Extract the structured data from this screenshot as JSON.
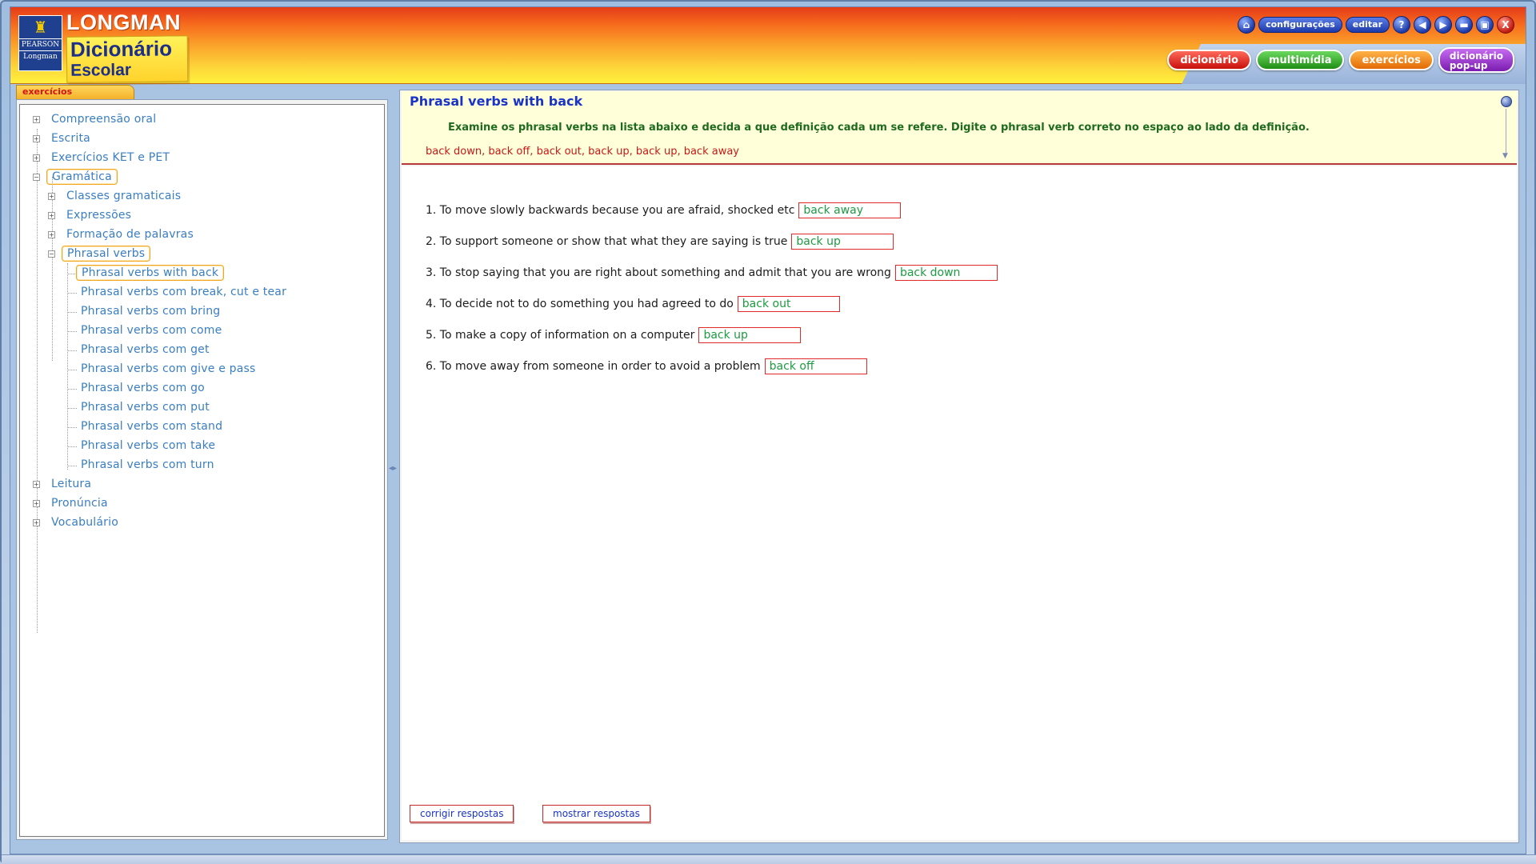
{
  "header": {
    "logo_ship_glyph": "♜",
    "logo_pearson": "PEARSON",
    "logo_longman_small": "Longman",
    "logo_longman": "LONGMAN",
    "logo_dicionario": "Dicionário",
    "logo_escolar": "Escolar"
  },
  "toolbar": {
    "home_glyph": "⌂",
    "configuracoes": "configurações",
    "editar": "editar",
    "help_glyph": "?",
    "back_glyph": "◀",
    "forward_glyph": "▶",
    "minimize_glyph": "▬",
    "maximize_glyph": "▣",
    "close_glyph": "X"
  },
  "nav_tabs": {
    "dicionario": "dicionário",
    "multimidia": "multimídia",
    "exercicios": "exercícios",
    "popup_line1": "dicionário",
    "popup_line2": "pop-up"
  },
  "left_panel": {
    "tab_label": "exercícios",
    "tree": {
      "compreensao": "Compreensão oral",
      "escrita": "Escrita",
      "ket_pet": "Exercícios KET e PET",
      "gramatica": "Gramática",
      "classes": "Classes gramaticais",
      "expressoes": "Expressões",
      "formacao": "Formação de palavras",
      "phrasal_verbs": "Phrasal verbs",
      "pv_back": "Phrasal verbs with back",
      "pv_break": "Phrasal verbs com break, cut e tear",
      "pv_bring": "Phrasal verbs com bring",
      "pv_come": "Phrasal verbs com come",
      "pv_get": "Phrasal verbs com get",
      "pv_give": "Phrasal verbs com give e pass",
      "pv_go": "Phrasal verbs com go",
      "pv_put": "Phrasal verbs com put",
      "pv_stand": "Phrasal verbs com stand",
      "pv_take": "Phrasal verbs com take",
      "pv_turn": "Phrasal verbs com turn",
      "leitura": "Leitura",
      "pronuncia": "Pronúncia",
      "vocabulario": "Vocabulário",
      "expander_plus": "+",
      "expander_minus": "−"
    },
    "splitter_glyph": "◂▸"
  },
  "exercise": {
    "title": "Phrasal verbs with back",
    "instructions": "Examine os phrasal verbs na lista abaixo e decida a que definição cada um se refere. Digite o phrasal verb correto no espaço ao lado da definição.",
    "word_list": "back down, back off, back out, back up, back up, back away",
    "scroll_arrow": "▼",
    "questions": [
      {
        "text": "1. To move slowly backwards because you are afraid, shocked etc",
        "answer": "back away"
      },
      {
        "text": "2. To support someone or show that what they are saying is true",
        "answer": "back up"
      },
      {
        "text": "3. To stop saying that you are right about something and admit that you are wrong",
        "answer": "back down"
      },
      {
        "text": "4. To decide not to do something you had agreed to do",
        "answer": "back out"
      },
      {
        "text": "5. To make a copy of information on a computer",
        "answer": "back up"
      },
      {
        "text": "6. To move away from someone in order to avoid a problem",
        "answer": "back off"
      }
    ],
    "btn_corrigir": "corrigir respostas",
    "btn_mostrar": "mostrar respostas"
  },
  "colors": {
    "link_blue": "#3a7ec2",
    "title_blue": "#1a34c8",
    "instruction_green": "#1e6a1e",
    "word_list_red": "#c81818",
    "answer_green": "#1e9a42",
    "input_border_red": "#e02a2a"
  }
}
